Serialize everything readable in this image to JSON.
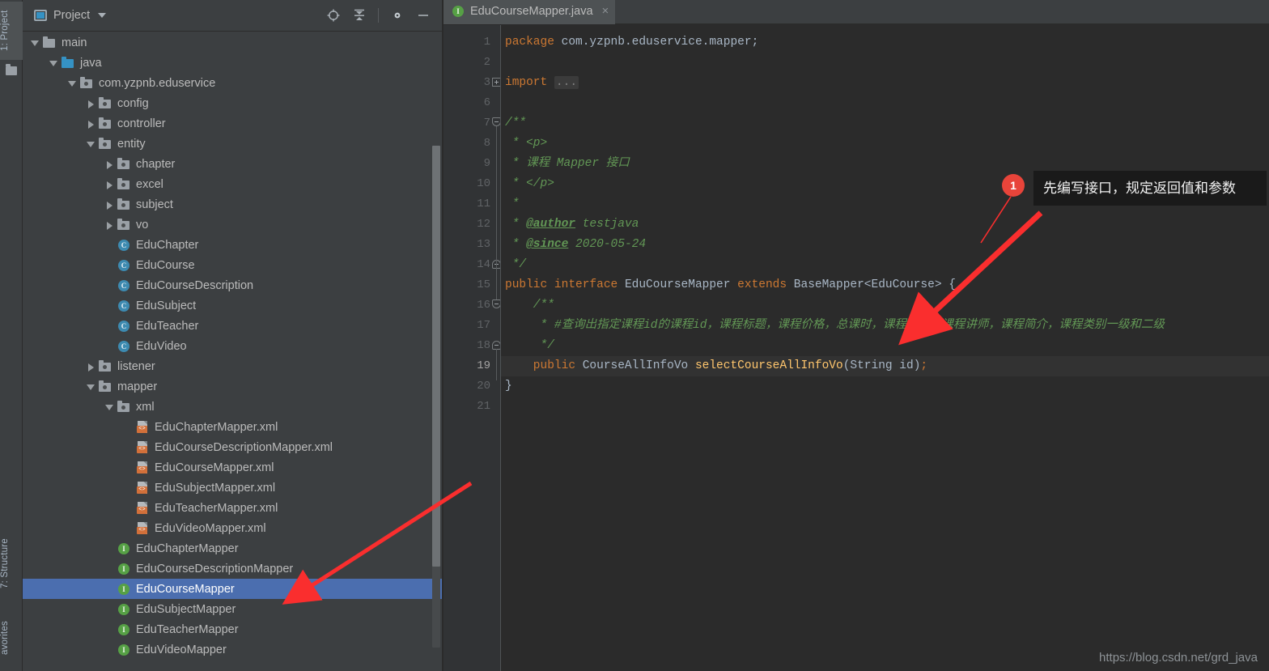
{
  "rail": {
    "project_tab": "1: Project",
    "structure_tab": "7: Structure",
    "favorites_tab": "avorites"
  },
  "panel": {
    "title": "Project",
    "tools": [
      {
        "name": "locate-icon",
        "label": "Select Opened File"
      },
      {
        "name": "collapse-all-icon",
        "label": "Collapse All"
      },
      {
        "name": "gear-icon",
        "label": "Settings"
      },
      {
        "name": "minimize-icon",
        "label": "Hide"
      }
    ]
  },
  "tree": [
    {
      "label": "main",
      "indent": 1,
      "twisty": "open",
      "icon": "folder"
    },
    {
      "label": "java",
      "indent": 2,
      "twisty": "open",
      "icon": "folder-src"
    },
    {
      "label": "com.yzpnb.eduservice",
      "indent": 3,
      "twisty": "open",
      "icon": "package"
    },
    {
      "label": "config",
      "indent": 4,
      "twisty": "closed",
      "icon": "package"
    },
    {
      "label": "controller",
      "indent": 4,
      "twisty": "closed",
      "icon": "package"
    },
    {
      "label": "entity",
      "indent": 4,
      "twisty": "open",
      "icon": "package"
    },
    {
      "label": "chapter",
      "indent": 5,
      "twisty": "closed",
      "icon": "package"
    },
    {
      "label": "excel",
      "indent": 5,
      "twisty": "closed",
      "icon": "package"
    },
    {
      "label": "subject",
      "indent": 5,
      "twisty": "closed",
      "icon": "package"
    },
    {
      "label": "vo",
      "indent": 5,
      "twisty": "closed",
      "icon": "package"
    },
    {
      "label": "EduChapter",
      "indent": 5,
      "twisty": "none",
      "icon": "class"
    },
    {
      "label": "EduCourse",
      "indent": 5,
      "twisty": "none",
      "icon": "class"
    },
    {
      "label": "EduCourseDescription",
      "indent": 5,
      "twisty": "none",
      "icon": "class"
    },
    {
      "label": "EduSubject",
      "indent": 5,
      "twisty": "none",
      "icon": "class"
    },
    {
      "label": "EduTeacher",
      "indent": 5,
      "twisty": "none",
      "icon": "class"
    },
    {
      "label": "EduVideo",
      "indent": 5,
      "twisty": "none",
      "icon": "class"
    },
    {
      "label": "listener",
      "indent": 4,
      "twisty": "closed",
      "icon": "package"
    },
    {
      "label": "mapper",
      "indent": 4,
      "twisty": "open",
      "icon": "package"
    },
    {
      "label": "xml",
      "indent": 5,
      "twisty": "open",
      "icon": "package"
    },
    {
      "label": "EduChapterMapper.xml",
      "indent": 6,
      "twisty": "none",
      "icon": "xml"
    },
    {
      "label": "EduCourseDescriptionMapper.xml",
      "indent": 6,
      "twisty": "none",
      "icon": "xml"
    },
    {
      "label": "EduCourseMapper.xml",
      "indent": 6,
      "twisty": "none",
      "icon": "xml"
    },
    {
      "label": "EduSubjectMapper.xml",
      "indent": 6,
      "twisty": "none",
      "icon": "xml"
    },
    {
      "label": "EduTeacherMapper.xml",
      "indent": 6,
      "twisty": "none",
      "icon": "xml"
    },
    {
      "label": "EduVideoMapper.xml",
      "indent": 6,
      "twisty": "none",
      "icon": "xml"
    },
    {
      "label": "EduChapterMapper",
      "indent": 5,
      "twisty": "none",
      "icon": "interface"
    },
    {
      "label": "EduCourseDescriptionMapper",
      "indent": 5,
      "twisty": "none",
      "icon": "interface"
    },
    {
      "label": "EduCourseMapper",
      "indent": 5,
      "twisty": "none",
      "icon": "interface",
      "selected": true
    },
    {
      "label": "EduSubjectMapper",
      "indent": 5,
      "twisty": "none",
      "icon": "interface"
    },
    {
      "label": "EduTeacherMapper",
      "indent": 5,
      "twisty": "none",
      "icon": "interface"
    },
    {
      "label": "EduVideoMapper",
      "indent": 5,
      "twisty": "none",
      "icon": "interface"
    }
  ],
  "editor": {
    "tab_label": "EduCourseMapper.java",
    "tab_close": "×",
    "line_numbers": [
      "1",
      "2",
      "3",
      "6",
      "7",
      "8",
      "9",
      "10",
      "11",
      "12",
      "13",
      "14",
      "15",
      "16",
      "17",
      "18",
      "19",
      "20",
      "21"
    ],
    "active_line": "19",
    "lines": [
      {
        "n": "1",
        "segs": [
          {
            "t": "package ",
            "c": "kw"
          },
          {
            "t": "com.yzpnb.eduservice.mapper;",
            "c": "plain"
          }
        ]
      },
      {
        "n": "2",
        "segs": []
      },
      {
        "n": "3",
        "segs": [
          {
            "t": "import ",
            "c": "kw"
          },
          {
            "t": "...",
            "c": "dots"
          }
        ]
      },
      {
        "n": "6",
        "segs": []
      },
      {
        "n": "7",
        "segs": [
          {
            "t": "/**",
            "c": "cmt"
          }
        ]
      },
      {
        "n": "8",
        "segs": [
          {
            "t": " * <p>",
            "c": "cmt"
          }
        ]
      },
      {
        "n": "9",
        "segs": [
          {
            "t": " * 课程 Mapper 接口",
            "c": "cmt"
          }
        ]
      },
      {
        "n": "10",
        "segs": [
          {
            "t": " * </p>",
            "c": "cmt"
          }
        ]
      },
      {
        "n": "11",
        "segs": [
          {
            "t": " *",
            "c": "cmt"
          }
        ]
      },
      {
        "n": "12",
        "segs": [
          {
            "t": " * ",
            "c": "cmt"
          },
          {
            "t": "@author",
            "c": "cmt-tag"
          },
          {
            "t": " testjava",
            "c": "cmt"
          }
        ]
      },
      {
        "n": "13",
        "segs": [
          {
            "t": " * ",
            "c": "cmt"
          },
          {
            "t": "@since",
            "c": "cmt-tag"
          },
          {
            "t": " 2020-05-24",
            "c": "cmt"
          }
        ]
      },
      {
        "n": "14",
        "segs": [
          {
            "t": " */",
            "c": "cmt"
          }
        ]
      },
      {
        "n": "15",
        "segs": [
          {
            "t": "public interface ",
            "c": "kw"
          },
          {
            "t": "EduCourseMapper ",
            "c": "type"
          },
          {
            "t": "extends ",
            "c": "kw"
          },
          {
            "t": "BaseMapper<EduCourse> {",
            "c": "type"
          }
        ]
      },
      {
        "n": "16",
        "segs": [
          {
            "t": "    /**",
            "c": "cmt"
          }
        ]
      },
      {
        "n": "17",
        "segs": [
          {
            "t": "     * #查询出指定课程id的课程id，课程标题，课程价格，总课时，课程封面，课程讲师，课程简介，课程类别一级和二级",
            "c": "cmt"
          }
        ]
      },
      {
        "n": "18",
        "segs": [
          {
            "t": "     */",
            "c": "cmt"
          }
        ]
      },
      {
        "n": "19",
        "segs": [
          {
            "t": "    public ",
            "c": "kw"
          },
          {
            "t": "CourseAllInfoVo ",
            "c": "type"
          },
          {
            "t": "selectCourseAllInfoVo",
            "c": "meth"
          },
          {
            "t": "(",
            "c": "plain"
          },
          {
            "t": "String",
            "c": "type"
          },
          {
            "t": " id)",
            "c": "plain"
          },
          {
            "t": ";",
            "c": "kw"
          }
        ]
      },
      {
        "n": "20",
        "segs": [
          {
            "t": "}",
            "c": "plain"
          }
        ]
      },
      {
        "n": "21",
        "segs": []
      }
    ]
  },
  "annotations": {
    "badge_1": "1",
    "callout_1": "先编写接口，规定返回值和参数",
    "arrow_1_name": "red-arrow-to-code",
    "arrow_2_name": "red-arrow-to-tree-item"
  },
  "watermark": "https://blog.csdn.net/grd_java",
  "colors": {
    "panel_bg": "#3c3f41",
    "editor_bg": "#2b2b2b",
    "gutter_bg": "#313335",
    "selection_blue": "#4b6eaf",
    "accent_red": "#e8443a",
    "keyword_orange": "#cc7832",
    "comment_green": "#629755",
    "method_yellow": "#ffc66d"
  }
}
